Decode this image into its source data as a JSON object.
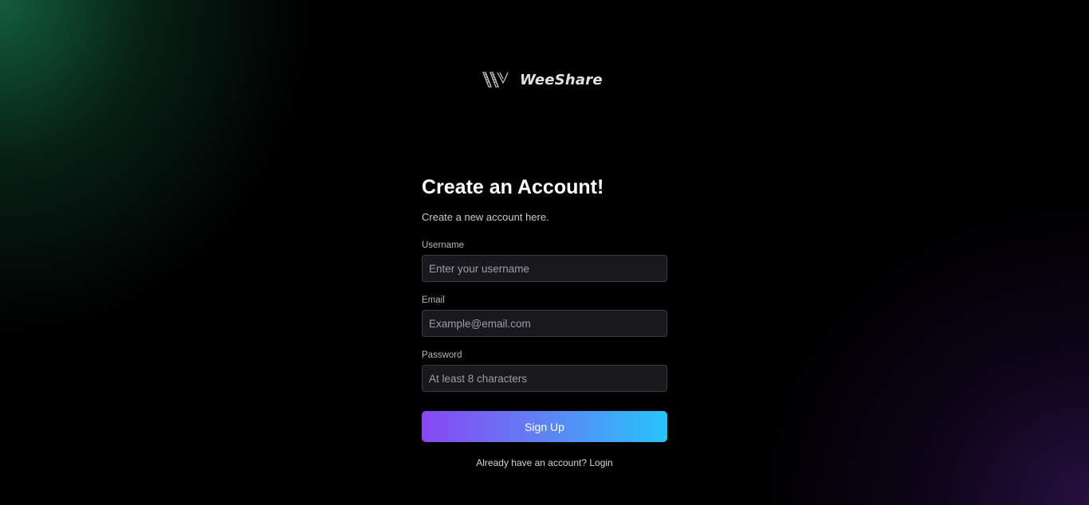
{
  "brand": {
    "name": "WeeShare",
    "logo_icon": "weeshare-w-logo-icon"
  },
  "form": {
    "title": "Create an Account!",
    "subtitle": "Create a new account here.",
    "fields": {
      "username": {
        "label": "Username",
        "placeholder": "Enter your username",
        "value": ""
      },
      "email": {
        "label": "Email",
        "placeholder": "Example@email.com",
        "value": ""
      },
      "password": {
        "label": "Password",
        "placeholder": "At least 8 characters",
        "value": ""
      }
    },
    "submit_label": "Sign Up",
    "login_prompt": "Already have an account?",
    "login_link": "Login"
  },
  "colors": {
    "background": "#000000",
    "button_gradient_start": "#8848f2",
    "button_gradient_end": "#26c4fb",
    "glow_top_left": "#166e46",
    "glow_bottom_right": "#2d124b"
  }
}
